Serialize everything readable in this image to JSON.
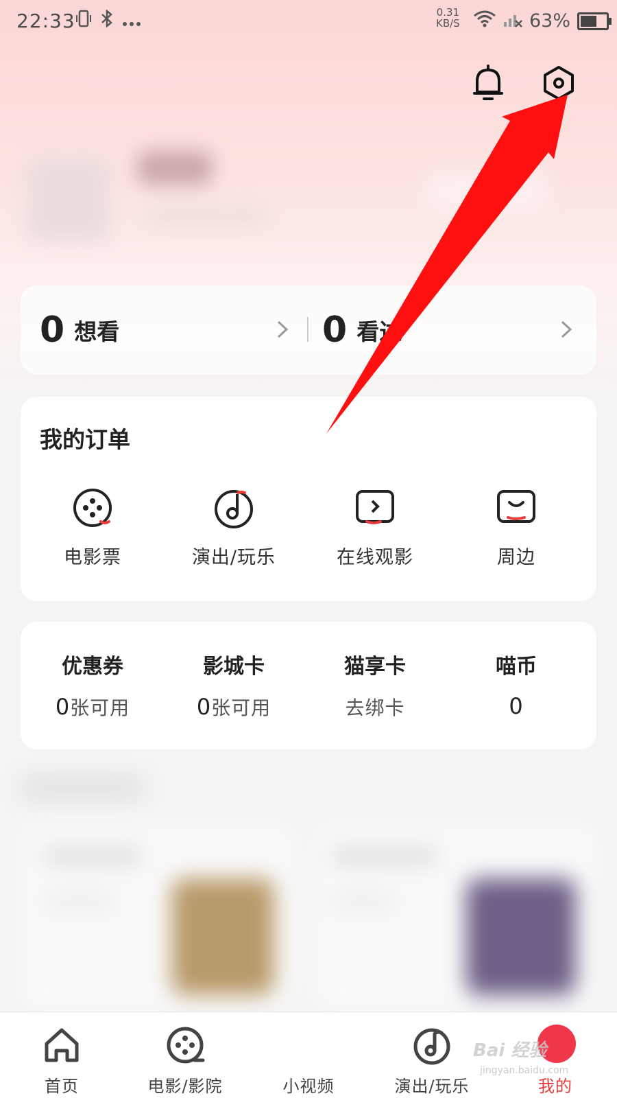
{
  "status_bar": {
    "time": "22:33",
    "speed_value": "0.31",
    "speed_unit": "KB/S",
    "battery": "63%",
    "battery_level": 0.63,
    "left_icons": [
      "vibrate-icon",
      "bluetooth-icon",
      "more-icon"
    ],
    "right_icons": [
      "wifi-icon",
      "signal-icon",
      "battery-icon"
    ]
  },
  "header": {
    "icons": [
      "bell-icon",
      "settings-gear-icon"
    ]
  },
  "counts": {
    "want": {
      "value": "0",
      "label": "想看"
    },
    "seen": {
      "value": "0",
      "label": "看过"
    }
  },
  "orders": {
    "title": "我的订单",
    "items": [
      {
        "label": "电影票",
        "icon": "film-reel-icon"
      },
      {
        "label": "演出/玩乐",
        "icon": "music-note-icon"
      },
      {
        "label": "在线观影",
        "icon": "play-screen-icon"
      },
      {
        "label": "周边",
        "icon": "shopping-bag-icon"
      }
    ]
  },
  "wallet": {
    "items": [
      {
        "title": "优惠券",
        "value": "0",
        "unit": "张可用"
      },
      {
        "title": "影城卡",
        "value": "0",
        "unit": "张可用"
      },
      {
        "title": "猫享卡",
        "value": "",
        "unit": "去绑卡"
      },
      {
        "title": "喵币",
        "value": "0",
        "unit": ""
      }
    ]
  },
  "bottom_nav": {
    "items": [
      {
        "label": "首页",
        "icon": "home-icon"
      },
      {
        "label": "电影/影院",
        "icon": "film-reel-icon"
      },
      {
        "label": "小视频",
        "icon": ""
      },
      {
        "label": "演出/玩乐",
        "icon": "music-note-icon"
      },
      {
        "label": "我的",
        "icon": "profile-icon",
        "active": true
      }
    ]
  },
  "watermark": {
    "brand": "Bai 经验",
    "url": "jingyan.baidu.com"
  },
  "colors": {
    "accent": "#e83c3c",
    "arrow": "#ff1010",
    "header_gradient_top": "#fbd6d6"
  }
}
